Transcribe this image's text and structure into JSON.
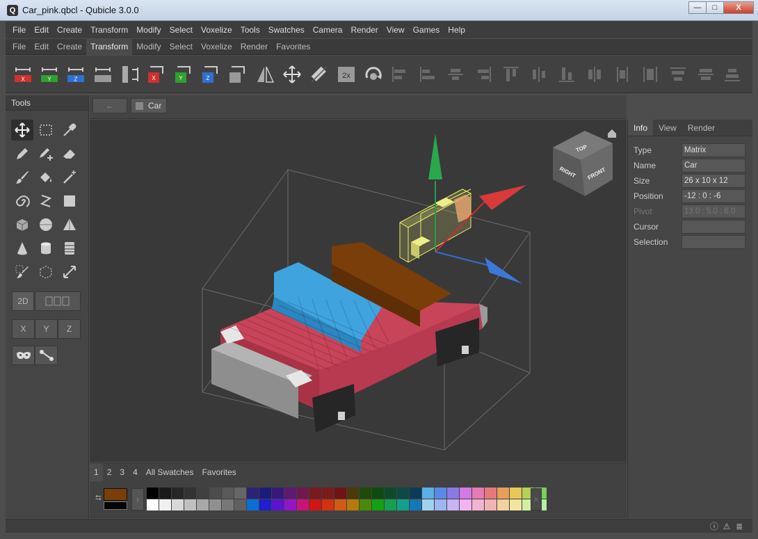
{
  "window": {
    "title": "Car_pink.qbcl - Qubicle 3.0.0",
    "app_icon_letter": "Q",
    "min": "—",
    "max": "□",
    "close": "X"
  },
  "menu": [
    "File",
    "Edit",
    "Create",
    "Transform",
    "Modify",
    "Select",
    "Voxelize",
    "Tools",
    "Swatches",
    "Camera",
    "Render",
    "View",
    "Games",
    "Help"
  ],
  "ribbon_tabs": [
    "File",
    "Edit",
    "Create",
    "Transform",
    "Modify",
    "Select",
    "Voxelize",
    "Render",
    "Favorites"
  ],
  "ribbon_active": "Transform",
  "toolbar_labels": {
    "x": "X",
    "y": "Y",
    "z": "Z",
    "scale2x": "2x"
  },
  "tools": {
    "header": "Tools",
    "btn_2d": "2D",
    "axis_x": "X",
    "axis_y": "Y",
    "axis_z": "Z"
  },
  "breadcrumb": {
    "back": "←",
    "item": "Car"
  },
  "view_cube": {
    "top": "TOP",
    "front": "FRONT",
    "right": "RIGHT"
  },
  "info": {
    "tabs": [
      "Info",
      "View",
      "Render"
    ],
    "active_tab": "Info",
    "rows": [
      {
        "label": "Type",
        "value": "Matrix"
      },
      {
        "label": "Name",
        "value": "Car"
      },
      {
        "label": "Size",
        "value": "26 x 10 x 12"
      },
      {
        "label": "Position",
        "value": "-12 : 0 : -6"
      },
      {
        "label": "Pivot",
        "value": "13.0 : 5.0 : 6.0",
        "disabled": true
      },
      {
        "label": "Cursor",
        "value": ""
      },
      {
        "label": "Selection",
        "value": ""
      }
    ]
  },
  "swatches": {
    "tabs": [
      "1",
      "2",
      "3",
      "4",
      "All Swatches",
      "Favorites"
    ],
    "active_tab": "1",
    "primary_color": "#7a3e08",
    "secondary_color": "#050505",
    "row1": [
      "#000000",
      "#1a1a1a",
      "#262626",
      "#333333",
      "#404040",
      "#4d4d4d",
      "#595959",
      "#666666",
      "#2c2277",
      "#1c1c7a",
      "#361a7a",
      "#5c1a72",
      "#6e1a4c",
      "#7a1a1a",
      "#7a1c1c",
      "#6e1414",
      "#4a3a0a",
      "#1e4a0a",
      "#0e4a14",
      "#0e4a2a",
      "#0e4a46",
      "#0e3a5a",
      "#5ab0e6",
      "#5a8ae6",
      "#8a7ae6",
      "#d27ae6",
      "#e67ab4",
      "#e67a7a",
      "#e6a05a",
      "#e6c85a",
      "#b4d25a",
      "#7ad25a"
    ],
    "row2": [
      "#ffffff",
      "#f0f0f0",
      "#d8d8d8",
      "#c0c0c0",
      "#a8a8a8",
      "#909090",
      "#787878",
      "#606060",
      "#0a6ed2",
      "#1e1ed2",
      "#5a14d2",
      "#9614c8",
      "#c81478",
      "#d21414",
      "#d23214",
      "#d25a14",
      "#b47a0a",
      "#4a8a0a",
      "#14a014",
      "#14a050",
      "#14a08c",
      "#1478b4",
      "#a0d2f0",
      "#a0b4f0",
      "#c8b4f0",
      "#f0b4f0",
      "#f0b4d2",
      "#f0b4b4",
      "#f0d2a0",
      "#f0e6a0",
      "#d2f0a0",
      "#b4f0a0"
    ]
  }
}
